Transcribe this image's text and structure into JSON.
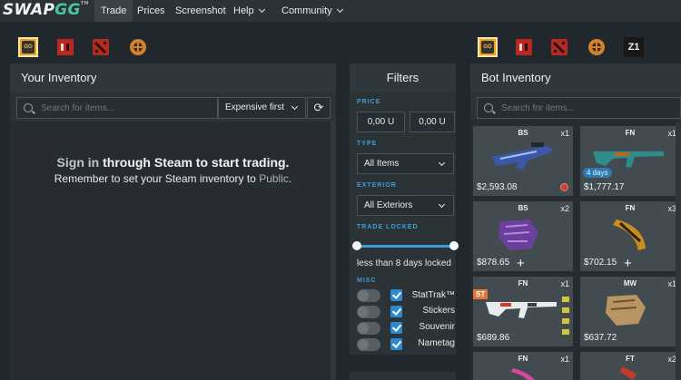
{
  "nav": {
    "logo_a": "SWAP",
    "logo_b": "GG",
    "logo_tm": "TM",
    "items": [
      "Trade",
      "Prices",
      "Screenshot",
      "Help",
      "Community"
    ]
  },
  "games_left": [
    "csgo-icon",
    "h1z1-icon",
    "dota2-icon",
    "tf2-icon"
  ],
  "games_right": [
    "csgo-icon",
    "h1z1-icon",
    "dota2-icon",
    "tf2-icon",
    "z1-icon"
  ],
  "icon_text": {
    "csgo": "GO",
    "z1": "Z1"
  },
  "your_inventory": {
    "title": "Your Inventory",
    "search_placeholder": "Search for items...",
    "sort_label": "Expensive first",
    "signin_link": "Sign in",
    "signin_rest": " through Steam to start trading.",
    "remember_text": "Remember to set your Steam inventory to ",
    "remember_link": "Public",
    "remember_end": "."
  },
  "filters": {
    "title": "Filters",
    "price_label": "PRICE",
    "price_min": "0,00 U",
    "price_max": "0,00 U",
    "type_label": "TYPE",
    "type_value": "All Items",
    "exterior_label": "EXTERIOR",
    "exterior_value": "All Exteriors",
    "trade_locked_label": "TRADE LOCKED",
    "trade_locked_text": "less than 8 days locked",
    "trade_locked_range": [
      0,
      1
    ],
    "misc_label": "MISC",
    "misc": [
      {
        "label": "StatTrak™",
        "checked": true
      },
      {
        "label": "Stickers",
        "checked": true
      },
      {
        "label": "Souvenir",
        "checked": true
      },
      {
        "label": "Nametag",
        "checked": true
      }
    ]
  },
  "bot_inventory": {
    "title": "Bot Inventory",
    "search_placeholder": "Search for items...",
    "items": [
      {
        "condition": "BS",
        "qty": "x1",
        "price": "$2,593.08"
      },
      {
        "condition": "FN",
        "qty": "x1",
        "price": "$1,777.17",
        "badge": "4 days"
      },
      {
        "condition": "BS",
        "qty": "x2",
        "price": "$878.65"
      },
      {
        "condition": "FN",
        "qty": "x3",
        "price": "$702.15"
      },
      {
        "condition": "FN",
        "qty": "x1",
        "price": "$689.86",
        "st": "ST"
      },
      {
        "condition": "MW",
        "qty": "x1",
        "price": "$637.72"
      },
      {
        "condition": "FN",
        "qty": "x1",
        "price": ""
      },
      {
        "condition": "FT",
        "qty": "x2",
        "price": ""
      }
    ]
  },
  "colors": {
    "accent": "#49c7a0",
    "blue": "#3a9fd8",
    "bg": "#20272d",
    "panel": "#2b3337"
  }
}
